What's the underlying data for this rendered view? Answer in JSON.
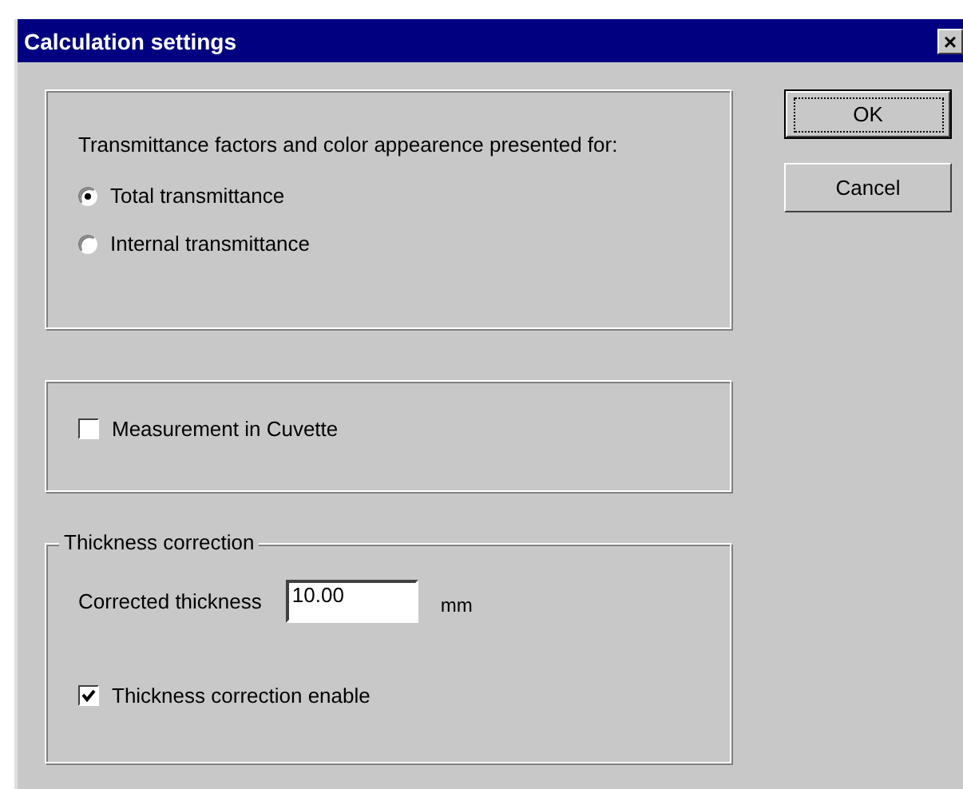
{
  "window": {
    "title": "Calculation settings",
    "close": "×"
  },
  "presentation": {
    "prompt": "Transmittance factors and color appearence presented for:",
    "options": [
      {
        "label": "Total transmittance",
        "selected": true
      },
      {
        "label": "Internal transmittance",
        "selected": false
      }
    ]
  },
  "cuvette": {
    "label": "Measurement in Cuvette",
    "checked": false
  },
  "thickness": {
    "legend": "Thickness correction",
    "field_label": "Corrected thickness",
    "value": "10.00",
    "unit": "mm",
    "enable": {
      "label": "Thickness correction enable",
      "checked": true
    }
  },
  "buttons": [
    {
      "label": "OK",
      "default": true
    },
    {
      "label": "Cancel",
      "default": false
    }
  ]
}
